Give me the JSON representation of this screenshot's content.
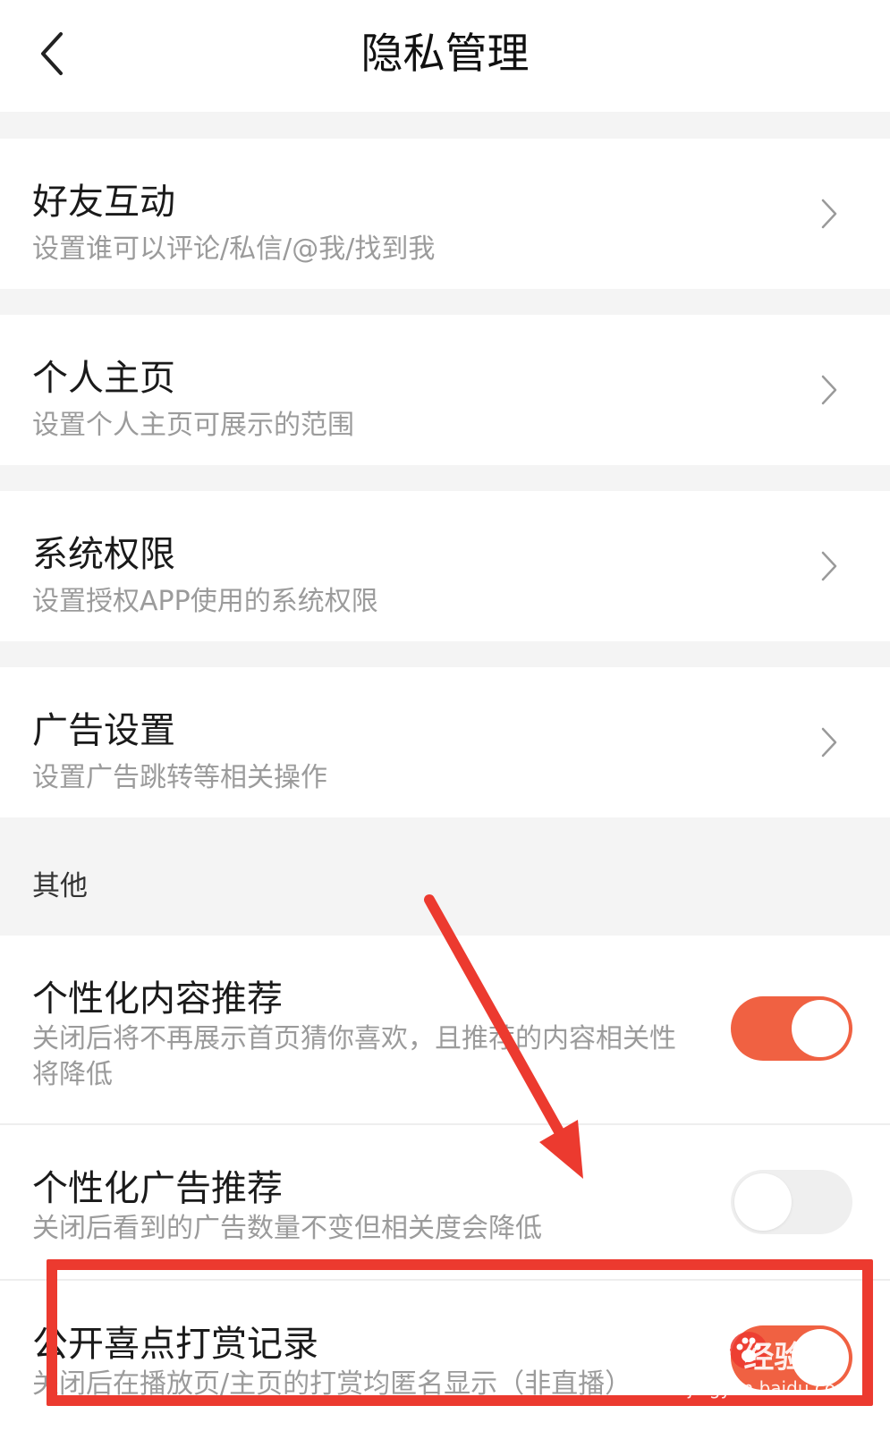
{
  "header": {
    "title": "隐私管理",
    "back_icon": "chevron-left-icon"
  },
  "nav_rows": [
    {
      "title": "好友互动",
      "subtitle": "设置谁可以评论/私信/@我/找到我"
    },
    {
      "title": "个人主页",
      "subtitle": "设置个人主页可展示的范围"
    },
    {
      "title": "系统权限",
      "subtitle": "设置授权APP使用的系统权限"
    },
    {
      "title": "广告设置",
      "subtitle": "设置广告跳转等相关操作"
    }
  ],
  "other_section": {
    "label": "其他",
    "items": [
      {
        "title": "个性化内容推荐",
        "subtitle": "关闭后将不再展示首页猜你喜欢，且推荐的内容相关性将降低",
        "enabled": true
      },
      {
        "title": "个性化广告推荐",
        "subtitle": "关闭后看到的广告数量不变但相关度会降低",
        "enabled": false
      },
      {
        "title": "公开喜点打赏记录",
        "subtitle": "关闭后在播放页/主页的打赏均匿名显示（非直播）",
        "enabled": true
      }
    ]
  },
  "colors": {
    "accent": "#f06142",
    "annotation": "#ec3a2f",
    "background": "#f4f4f4"
  },
  "watermark": {
    "brand": "Bai 经验",
    "url": "jingyan.baidu.com"
  }
}
